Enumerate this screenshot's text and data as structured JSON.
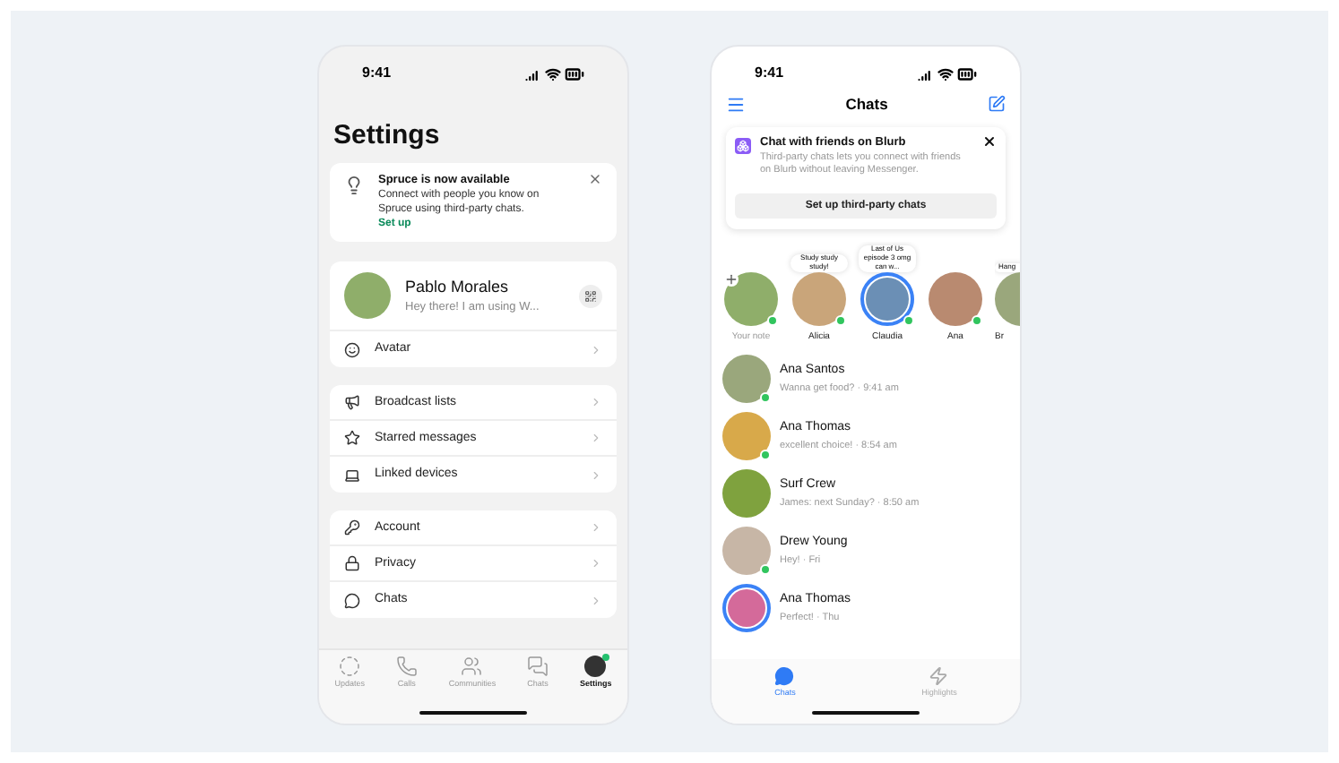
{
  "settings_phone": {
    "time": "9:41",
    "title": "Settings",
    "banner": {
      "title": "Spruce is now available",
      "body": "Connect with people you know on Spruce using third-party chats.",
      "link": "Set up"
    },
    "profile": {
      "name": "Pablo Morales",
      "status": "Hey there! I am using W..."
    },
    "groups": [
      [
        {
          "kind": "avatar",
          "label": "Avatar"
        }
      ],
      [
        {
          "kind": "broadcast",
          "label": "Broadcast lists"
        },
        {
          "kind": "starred",
          "label": "Starred messages"
        },
        {
          "kind": "devices",
          "label": "Linked devices"
        }
      ],
      [
        {
          "kind": "account",
          "label": "Account"
        },
        {
          "kind": "privacy",
          "label": "Privacy"
        },
        {
          "kind": "chats",
          "label": "Chats"
        }
      ]
    ],
    "tabs": [
      {
        "kind": "updates",
        "label": "Updates",
        "selected": false,
        "badge": false
      },
      {
        "kind": "calls",
        "label": "Calls",
        "selected": false,
        "badge": false
      },
      {
        "kind": "communities",
        "label": "Communities",
        "selected": false,
        "badge": false
      },
      {
        "kind": "chats",
        "label": "Chats",
        "selected": false,
        "badge": false
      },
      {
        "kind": "settings",
        "label": "Settings",
        "selected": true,
        "badge": true
      }
    ]
  },
  "chats_phone": {
    "time": "9:41",
    "title": "Chats",
    "banner": {
      "title": "Chat with friends on Blurb",
      "body": "Third-party chats lets you connect with friends on Blurb without leaving Messenger.",
      "button": "Set up third-party chats"
    },
    "stories": [
      {
        "label": "Your note",
        "online": true,
        "ring": false,
        "add": true,
        "partial": false
      },
      {
        "label": "Alicia",
        "note": "Study study study!",
        "online": true,
        "ring": false,
        "add": false,
        "partial": false
      },
      {
        "label": "Claudia",
        "note": "Last of Us episode 3 omg can w...",
        "online": true,
        "ring": true,
        "add": false,
        "partial": false
      },
      {
        "label": "Ana",
        "online": true,
        "ring": false,
        "add": false,
        "partial": false
      },
      {
        "label": "Br",
        "note": "Hang",
        "online": false,
        "ring": false,
        "add": false,
        "partial": true
      }
    ],
    "chats": [
      {
        "name": "Ana Santos",
        "preview": "Wanna get food? · 9:41 am",
        "online": true,
        "ring": false
      },
      {
        "name": "Ana Thomas",
        "preview": "excellent choice! · 8:54 am",
        "online": true,
        "ring": false
      },
      {
        "name": "Surf Crew",
        "preview": "James: next Sunday? · 8:50 am",
        "online": false,
        "ring": false
      },
      {
        "name": "Drew Young",
        "preview": "Hey! · Fri",
        "online": true,
        "ring": false
      },
      {
        "name": "Ana Thomas",
        "preview": "Perfect! · Thu",
        "online": false,
        "ring": true
      }
    ],
    "tabs": [
      {
        "kind": "chats",
        "label": "Chats",
        "selected": true
      },
      {
        "kind": "highlights",
        "label": "Highlights",
        "selected": false
      }
    ]
  }
}
